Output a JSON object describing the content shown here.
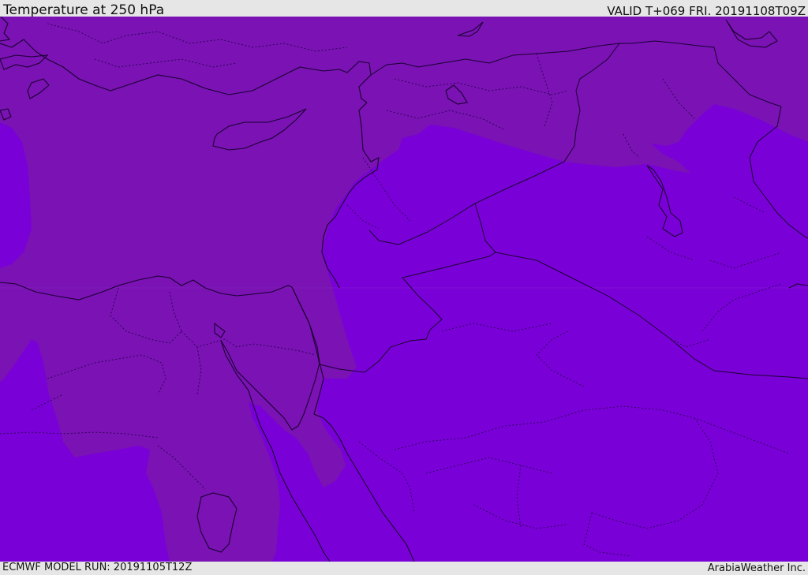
{
  "header": {
    "title": "Temperature at 250 hPa",
    "valid_time": "VALID T+069 FRI. 20191108T09Z"
  },
  "footer": {
    "model_run": "ECMWF MODEL RUN: 20191105T12Z",
    "credit": "ArabiaWeather Inc."
  },
  "colors": {
    "warmer_band": "#7a12b4",
    "colder_band": "#7a00d8",
    "boundaries": "#1a0030",
    "frame": "#e6e6e6"
  }
}
